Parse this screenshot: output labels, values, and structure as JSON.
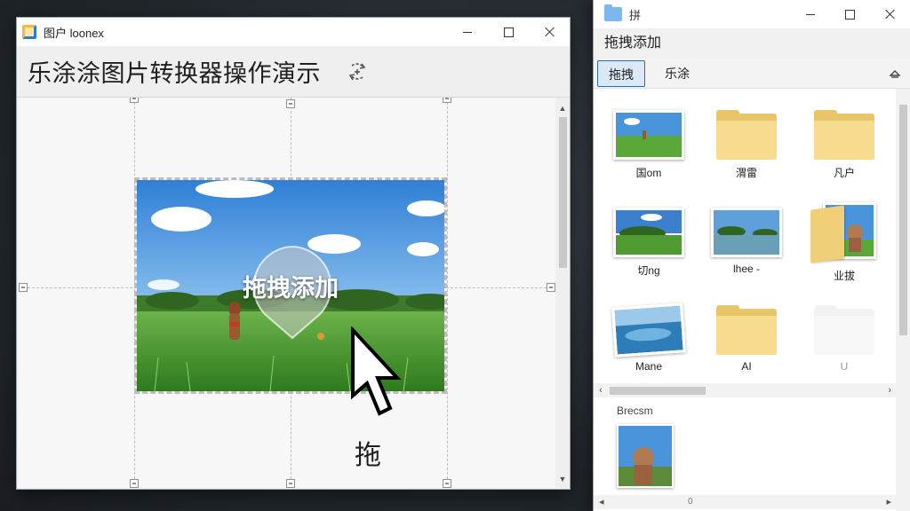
{
  "left_window": {
    "title": "图户 loonex",
    "heading": "乐涂涂图片转换器操作演示",
    "drop_label": "拖拽添加",
    "drag_hint": "拖"
  },
  "right_window": {
    "title": "拼",
    "header": "拖拽添加",
    "tabs": [
      "拖拽",
      "乐涂"
    ],
    "files": [
      {
        "caption": "国om",
        "kind": "photo"
      },
      {
        "caption": "渭雷",
        "kind": "folder"
      },
      {
        "caption": "凡户",
        "kind": "folder"
      },
      {
        "caption": "切ng",
        "kind": "photo"
      },
      {
        "caption": "lhee -",
        "kind": "photo"
      },
      {
        "caption": "业拔",
        "kind": "folder-photo"
      },
      {
        "caption": "Mane",
        "kind": "photo"
      },
      {
        "caption": "AI",
        "kind": "folder"
      },
      {
        "caption": "U",
        "kind": "folder-faded"
      }
    ],
    "section_label": "Brecsm",
    "bottom_scroll_label": "0"
  },
  "colors": {
    "accent": "#2f6aa8",
    "folder": "#f7dc8f",
    "sky": "#3d8fdc",
    "grass": "#4a9a2e"
  },
  "icons": [
    "app-icon",
    "rotate-icon",
    "folder-icon",
    "cursor-icon",
    "collapse-icon"
  ]
}
